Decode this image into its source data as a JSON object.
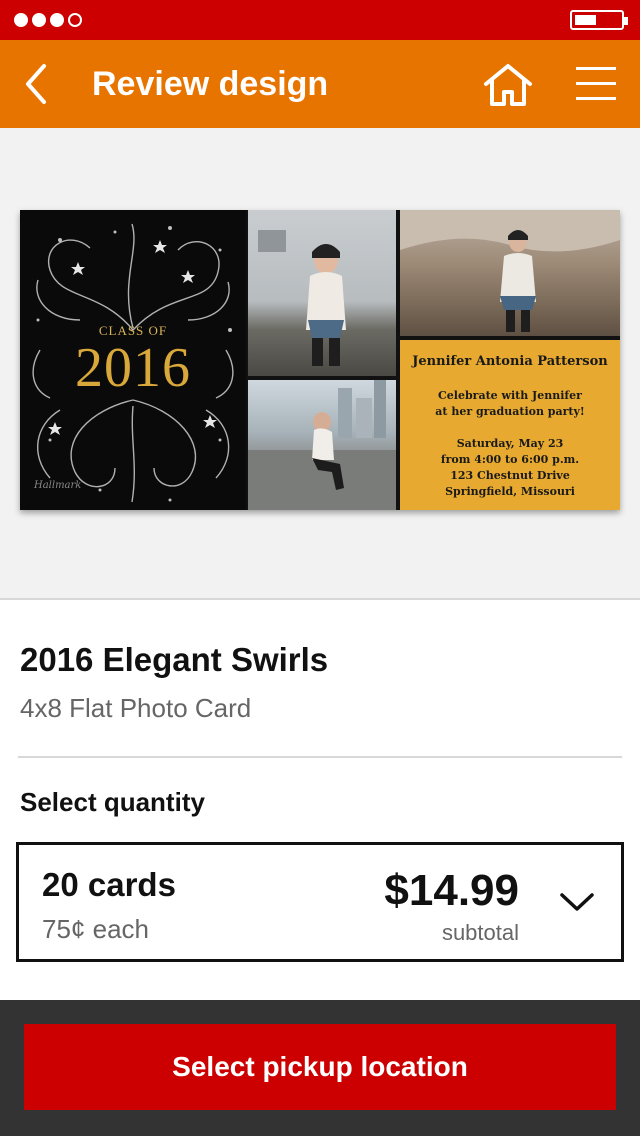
{
  "status_bar": {
    "signal_dots": 4,
    "signal_filled": 3,
    "battery_level": 0.45
  },
  "nav": {
    "title": "Review design",
    "back_icon": "chevron-left-icon",
    "home_icon": "home-icon",
    "menu_icon": "hamburger-menu-icon"
  },
  "card_preview": {
    "class_of": "CLASS OF",
    "year": "2016",
    "brand_mark": "Hallmark",
    "name": "Jennifer Antonia Patterson",
    "invite_line1": "Celebrate with Jennifer",
    "invite_line2": "at her graduation party!",
    "date": "Saturday, May 23",
    "time": "from 4:00 to 6:00 p.m.",
    "address": "123 Chestnut Drive",
    "city": "Springfield, Missouri",
    "colors": {
      "panel": "#e7a92f",
      "gold": "#d9a83a"
    }
  },
  "product": {
    "title": "2016 Elegant Swirls",
    "subtitle": "4x8 Flat Photo Card"
  },
  "quantity": {
    "label": "Select quantity",
    "count": "20 cards",
    "each": "75¢ each",
    "price": "$14.99",
    "price_note": "subtotal",
    "chevron_icon": "chevron-down-icon"
  },
  "footer": {
    "cta_label": "Select pickup location"
  },
  "colors": {
    "status_bar": "#cc0000",
    "nav_bar": "#e87400",
    "cta": "#cc0000",
    "footer_bg": "#333333"
  }
}
